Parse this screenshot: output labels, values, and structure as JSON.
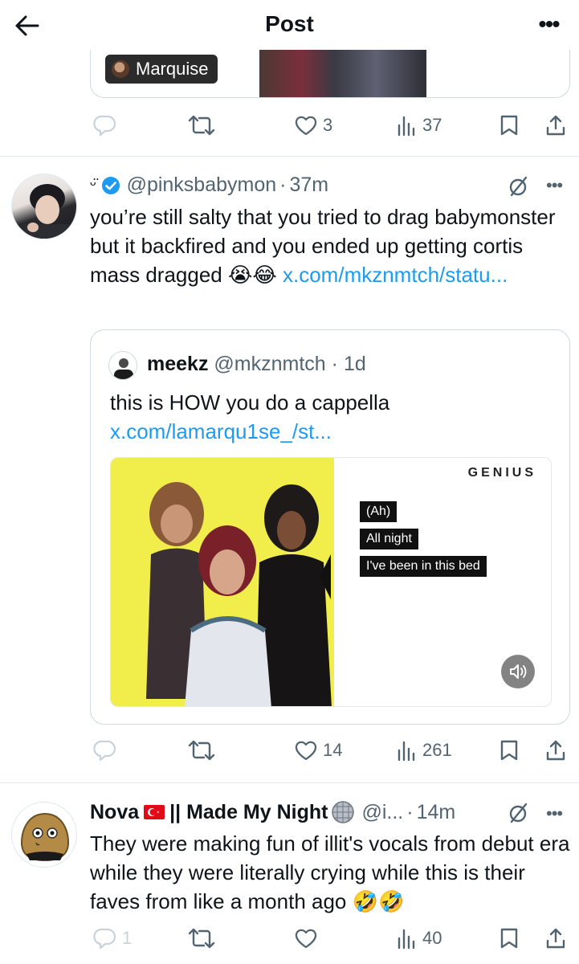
{
  "header": {
    "title": "Post"
  },
  "prev_tweet": {
    "tag_label": "Marquise",
    "actions": {
      "retweets": "",
      "likes": "3",
      "views": "37"
    }
  },
  "tweet1": {
    "badge": "ᵕ̈",
    "handle": "@pinksbabymon",
    "time": "37m",
    "text": "you’re still salty that you tried to drag babymonster but it backfired and you ended up getting cortis mass dragged",
    "emojis": "😭😂",
    "link": "x.com/mkznmtch/statu...",
    "actions": {
      "likes": "14",
      "views": "261"
    }
  },
  "quote": {
    "name": "meekz",
    "handle": "@mkznmtch",
    "time": "1d",
    "text": "this is HOW you do a cappella",
    "link": "x.com/lamarqu1se_/st...",
    "media": {
      "brand": "GENIUS",
      "lyrics": [
        "(Ah)",
        "All night",
        "I've been in this bed"
      ]
    }
  },
  "tweet2": {
    "name": "Nova",
    "name_suffix": "|| Made My Night",
    "handle": "@i...",
    "time": "14m",
    "text": "They were making fun of illit's vocals from debut era while they were literally crying while this is their faves from like a month ago",
    "emojis": "🤣🤣",
    "actions": {
      "replies": "1",
      "views": "40"
    }
  },
  "colors": {
    "link": "#1d9bf0",
    "muted": "#536471",
    "verified": "#1d9bf0",
    "media_yellow": "#f1ee4b"
  }
}
